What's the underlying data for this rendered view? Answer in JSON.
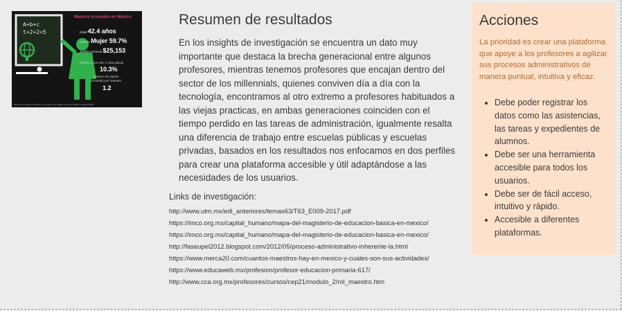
{
  "infographic": {
    "title": "Maestro promedio en México",
    "board_lines": [
      "A+b+c",
      "t+2+2=5"
    ],
    "age_label": "Edad",
    "age_value": "42.4 años",
    "gender_label": "Género",
    "gender_value": "Mujer 59.7%",
    "salary_label": "Sueldo mensual",
    "salary_value": "$25,153",
    "multi_label": "Maestros con dos o más plazas",
    "multi_value": "10.3%",
    "avg_label": "Número de plazas promedio por maestro",
    "avg_value": "1.2",
    "footer": "Maestro promedio en México, por posición con datos del Censo INEGI y análisis IMCO"
  },
  "main": {
    "title": "Resumen de resultados",
    "paragraph": "En los insights de investigación se encuentra un dato muy importante que destaca la brecha generacional entre algunos profesores, mientras tenemos profesores que encajan dentro del sector de los millennials, quienes conviven día a día con la tecnología, encontramos al otro extremo a profesores habituados a las viejas practicas, en ambas generaciones coinciden con el tiempo perdido en las tareas de administración, igualmente resalta una diferencia de trabajo entre escuelas públicas y escuelas privadas, basados en los resultados nos enfocamos en dos perfiles para crear una plataforma accesible y útil adaptándose a las necesidades de los usuarios."
  },
  "links": {
    "title": "Links de investigación:",
    "items": [
      "http://www.utm.mx/edi_anteriores/temas63/T63_E009-2017.pdf",
      "https://imco.org.mx/capital_humano/mapa-del-magisterio-de-educacion-basica-en-mexico/",
      "https://imco.org.mx/capital_humano/mapa-del-magisterio-de-educacion-basica-en-mexico/",
      "http://faseupel2012.blogspot.com/2012/05/proceso-administrativo-inherente-la.html",
      "https://www.merca20.com/cuantos-maestros-hay-en-mexico-y-cuales-son-sus-actividades/",
      "https://www.educaweb.mx/profesion/profesor-educacion-primaria-617/",
      "http://www.cca.org.mx/profesores/cursos/cep21/modulo_2/rol_maestro.htm"
    ]
  },
  "acciones": {
    "title": "Acciones",
    "intro": "La prioridad es crear una plataforma que apoye a los profesores a agilizar sus procesos administrativos de manera puntual, intuitiva y eficaz.",
    "items": [
      "Debe poder registrar los datos como las asistencias, las tareas y expedientes de alumnos.",
      "Debe ser una herramienta accesible para todos los usuarios.",
      "Debe ser de fácil acceso, intuitivo y rápido.",
      "Accesible a diferentes plataformas."
    ]
  },
  "colors": {
    "panel_bg": "#fde1cb",
    "intro_text": "#b16a2c",
    "infographic_accent": "#e8336b",
    "teacher_green": "#2fb24c"
  }
}
